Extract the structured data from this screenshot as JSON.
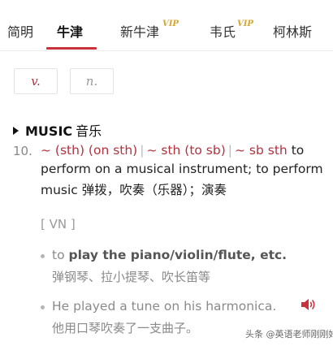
{
  "tabs": [
    {
      "label": "简明"
    },
    {
      "label": "牛津"
    },
    {
      "label": "新牛津"
    },
    {
      "label": "韦氏"
    },
    {
      "label": "柯林斯"
    }
  ],
  "vip_badge": "VIP",
  "pos": {
    "verb": "v.",
    "noun": "n."
  },
  "sense": {
    "keyword": "MUSIC",
    "zh": "音乐"
  },
  "definition": {
    "number": "10.",
    "patterns": [
      "~ (sth) (on sth)",
      "~ sth (to sb)",
      "~ sb sth"
    ],
    "separator": "|",
    "line1_tail": "to",
    "line2": "perform on a musical instrument; to perform",
    "line3": "music 弹拨，吹奏（乐器）；演奏"
  },
  "grammar_label": "[ VN ]",
  "examples": [
    {
      "en_prefix": "to ",
      "en_bold": "play the piano/violin/flute, etc.",
      "zh": "弹钢琴、拉小提琴、吹长笛等"
    },
    {
      "en_prefix": "He played a tune on his harmonica.",
      "en_bold": "",
      "zh": "他用口琴吹奏了一支曲子。"
    }
  ],
  "watermark": "头条 @英语老师刚刚好",
  "colors": {
    "accent": "#c9313d",
    "pattern": "#b3323f",
    "vip": "#d8a431"
  },
  "icons": {
    "speaker": "speaker-icon",
    "triangle": "triangle-right-icon"
  }
}
